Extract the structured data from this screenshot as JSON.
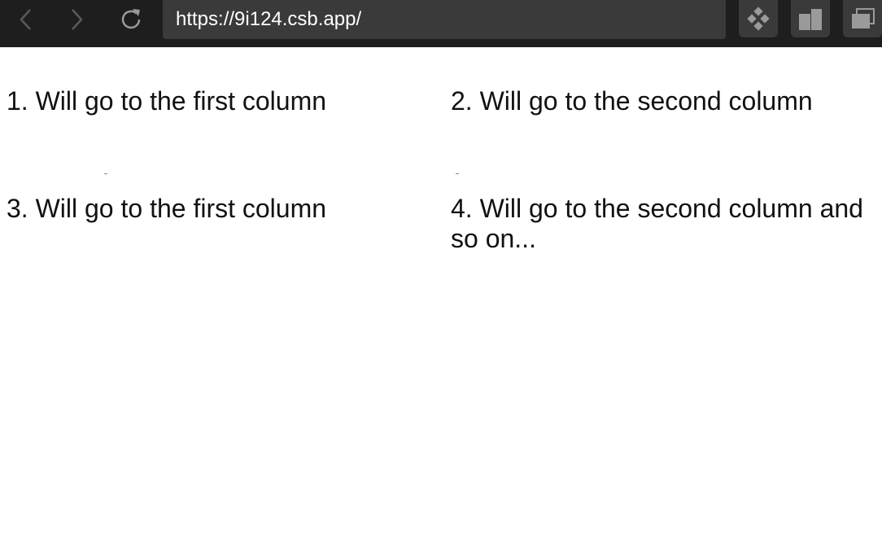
{
  "browser": {
    "url": "https://9i124.csb.app/",
    "back_icon": "chevron-left-icon",
    "forward_icon": "chevron-right-icon",
    "reload_icon": "reload-icon",
    "tools": [
      "devtools-icon",
      "split-view-icon",
      "new-window-icon"
    ]
  },
  "page": {
    "items": [
      "1. Will go to the first column",
      "2. Will go to the second column",
      "3. Will go to the first column",
      "4. Will go to the second column and so on..."
    ]
  }
}
